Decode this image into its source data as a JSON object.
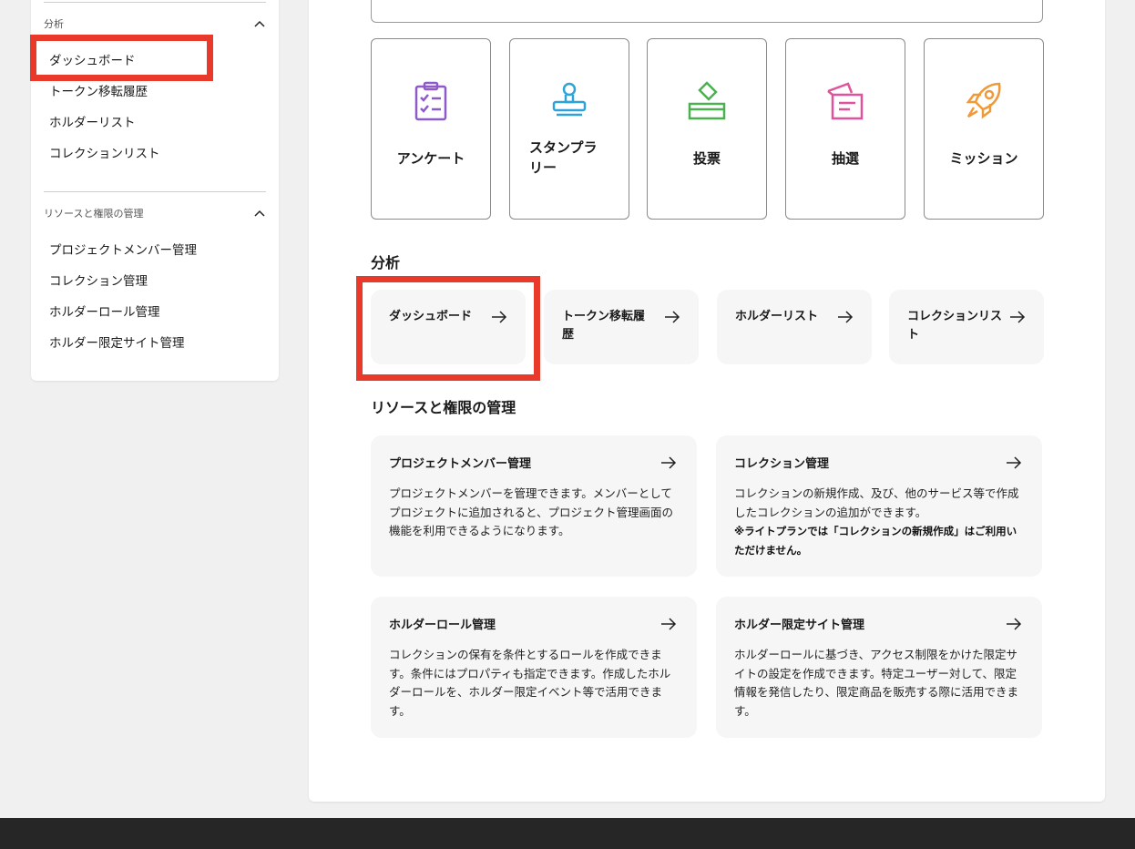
{
  "sidebar": {
    "analysis": {
      "heading": "分析",
      "items": [
        "ダッシュボード",
        "トークン移転履歴",
        "ホルダーリスト",
        "コレクションリスト"
      ]
    },
    "resources": {
      "heading": "リソースと権限の管理",
      "items": [
        "プロジェクトメンバー管理",
        "コレクション管理",
        "ホルダーロール管理",
        "ホルダー限定サイト管理"
      ]
    }
  },
  "features": [
    {
      "label": "アンケート",
      "icon": "survey-clipboard-icon",
      "color": "#8e5ac8"
    },
    {
      "label": "スタンプラリー",
      "line1": "スタンプラ",
      "line2": "リー",
      "icon": "stamp-icon",
      "color": "#2ea3d8"
    },
    {
      "label": "投票",
      "icon": "ballot-box-icon",
      "color": "#4caf50"
    },
    {
      "label": "抽選",
      "icon": "lottery-box-icon",
      "color": "#e0539a"
    },
    {
      "label": "ミッション",
      "icon": "rocket-icon",
      "color": "#ef9a3a"
    }
  ],
  "analysis": {
    "title": "分析",
    "cards": [
      {
        "label": "ダッシュボード"
      },
      {
        "label": "トークン移転履歴",
        "line1": "トークン移転履",
        "line2": "歴"
      },
      {
        "label": "ホルダーリスト"
      },
      {
        "label": "コレクションリスト",
        "line1": "コレクションリス",
        "line2": "ト"
      }
    ]
  },
  "resources": {
    "title": "リソースと権限の管理",
    "cards": [
      {
        "title": "プロジェクトメンバー管理",
        "desc": "プロジェクトメンバーを管理できます。メンバーとしてプロジェクトに追加されると、プロジェクト管理画面の機能を利用できるようになります。"
      },
      {
        "title": "コレクション管理",
        "desc": "コレクションの新規作成、及び、他のサービス等で作成したコレクションの追加ができます。",
        "note": "※ライトプランでは「コレクションの新規作成」はご利用いただけません。"
      },
      {
        "title": "ホルダーロール管理",
        "desc": "コレクションの保有を条件とするロールを作成できます。条件にはプロパティも指定できます。作成したホルダーロールを、ホルダー限定イベント等で活用できます。"
      },
      {
        "title": "ホルダー限定サイト管理",
        "desc": "ホルダーロールに基づき、アクセス制限をかけた限定サイトの設定を作成できます。特定ユーザー対して、限定情報を発信したり、限定商品を販売する際に活用できます。"
      }
    ]
  },
  "colors": {
    "highlight": "#e8392a",
    "card_bg": "#f6f6f6",
    "footer": "#262626"
  }
}
